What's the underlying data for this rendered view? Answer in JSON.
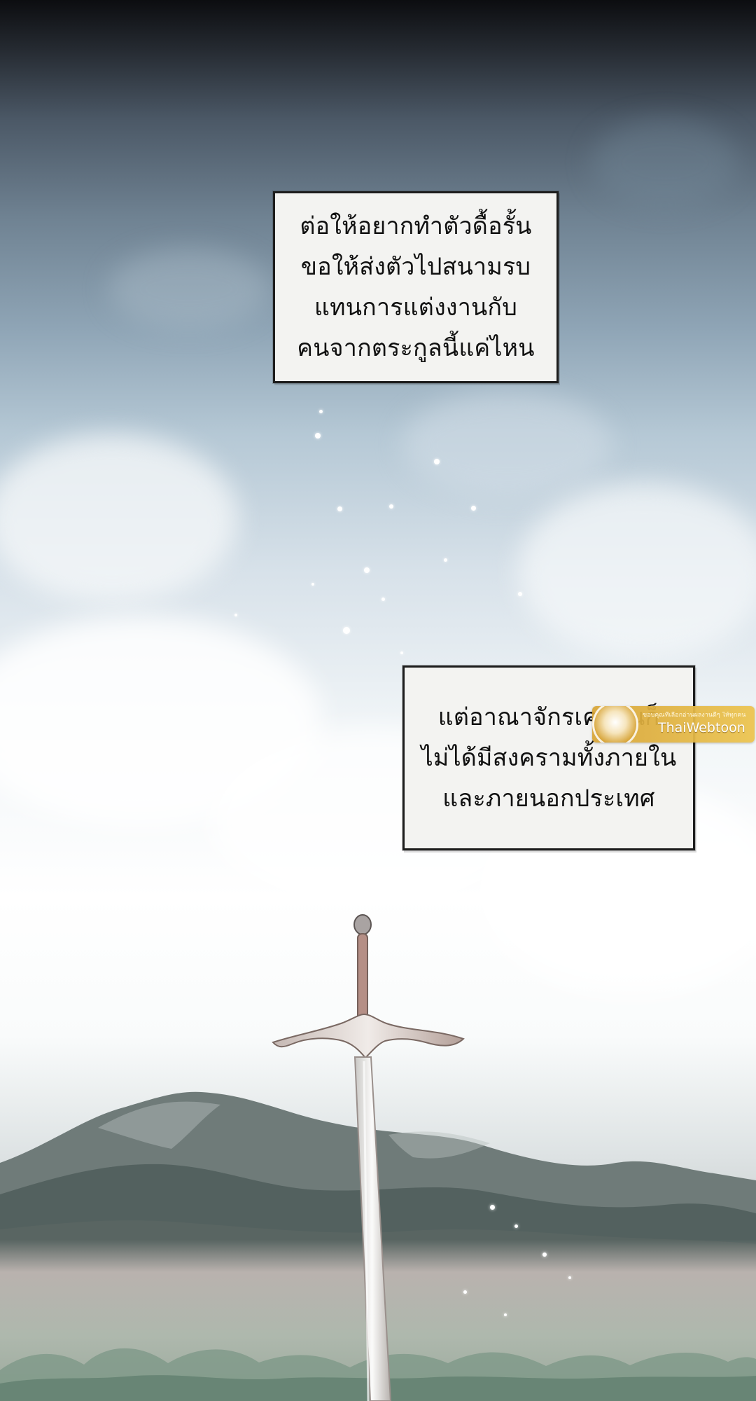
{
  "panel": {
    "caption_top": {
      "lines": [
        "ต่อให้อยากทำตัวดื้อรั้น",
        "ขอให้ส่งตัวไปสนามรบ",
        "แทนการแต่งงานกับ",
        "คนจากตระกูลนี้แค่ไหน"
      ]
    },
    "caption_bottom": {
      "lines": [
        "แต่อาณาจักรเคฟรันก็",
        "ไม่ได้มีสงครามทั้งภายใน",
        "และภายนอกประเทศ"
      ]
    }
  },
  "watermark": {
    "small_text": "ขอบคุณที่เลือกอ่านผลงานดีๆ ให้ทุกคน",
    "brand": "ThaiWebtoon"
  },
  "colors": {
    "caption_bg": "#f3f3f1",
    "caption_border": "#1d1d1d",
    "watermark_gold": "#d7a435",
    "sky_dark": "#0c0d10",
    "sky_light": "#ffffff"
  }
}
